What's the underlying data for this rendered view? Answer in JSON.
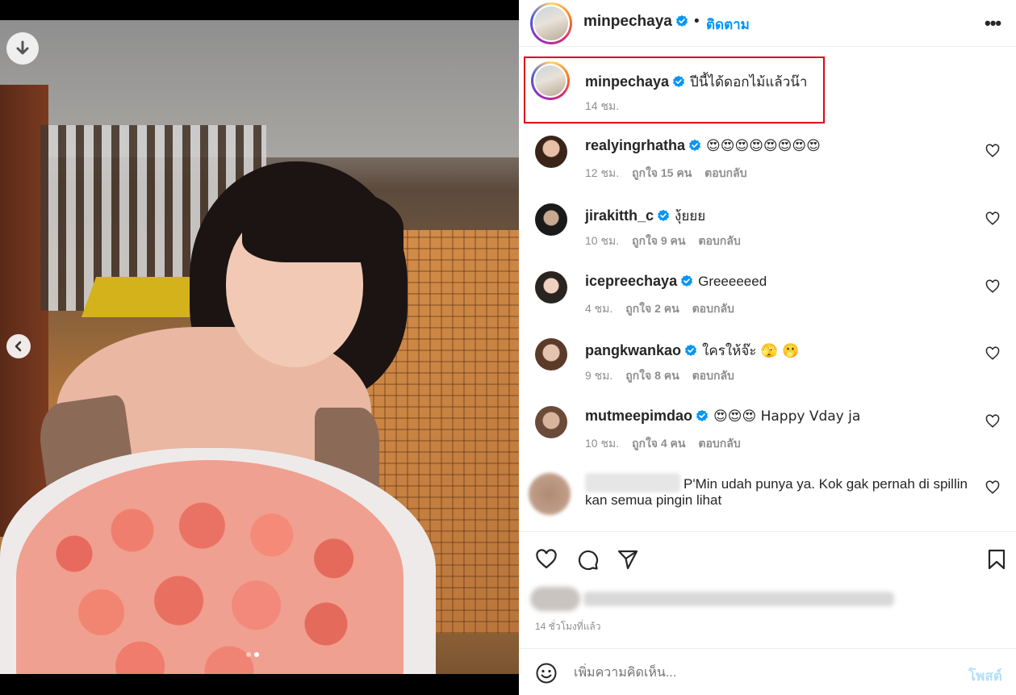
{
  "post": {
    "username": "minpechaya",
    "separator": "•",
    "follow_label": "ติดตาม",
    "more_icon": "more-horizontal-icon",
    "more_label": "•••"
  },
  "caption": {
    "username": "minpechaya",
    "text": "ปีนี้ได้ดอกไม้แล้วน๊า",
    "time": "14 ชม."
  },
  "comments": [
    {
      "username": "realyingrhatha",
      "text": "😍😍😍😍😍😍😍😍",
      "time": "12 ชม.",
      "likes": "ถูกใจ 15 คน",
      "reply": "ตอบกลับ"
    },
    {
      "username": "jirakitth_c",
      "text": "งุ้ยยย",
      "time": "10 ชม.",
      "likes": "ถูกใจ 9 คน",
      "reply": "ตอบกลับ"
    },
    {
      "username": "icepreechaya",
      "text": "Greeeeeed",
      "time": "4 ชม.",
      "likes": "ถูกใจ 2 คน",
      "reply": "ตอบกลับ"
    },
    {
      "username": "pangkwankao",
      "text": "ใครให้จ๊ะ 🫣 🫢",
      "time": "9 ชม.",
      "likes": "ถูกใจ 8 คน",
      "reply": "ตอบกลับ"
    },
    {
      "username": "mutmeepimdao",
      "text": "😍😍😍 Happy Vday ja",
      "time": "10 ชม.",
      "likes": "ถูกใจ 4 คน",
      "reply": "ตอบกลับ"
    },
    {
      "username": "",
      "text_line1": "P'Min udah punya ya. Kok gak pernah di spillin",
      "text_line2": "kan semua pingin lihat"
    }
  ],
  "actions": {
    "time_ago": "14 ชั่วโมงที่แล้ว"
  },
  "add_comment": {
    "placeholder": "เพิ่มความคิดเห็น...",
    "post_label": "โพสต์"
  },
  "colors": {
    "follow_blue": "#0095f6",
    "verified_blue": "#0095f6",
    "highlight_red": "#e0001a",
    "post_disabled": "#b2dffc"
  },
  "carousel": {
    "total_slides": 2,
    "active_slide": 2
  }
}
